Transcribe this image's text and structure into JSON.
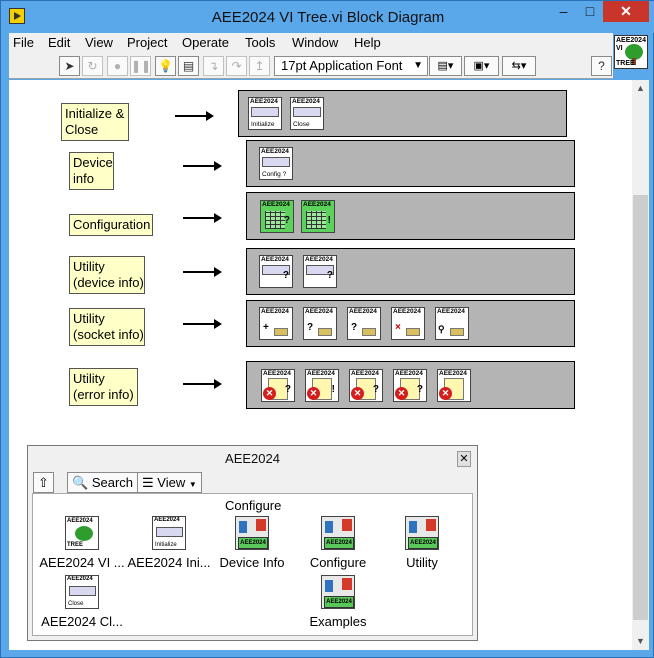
{
  "window": {
    "title": "AEE2024 VI Tree.vi Block Diagram",
    "min_label": "–",
    "max_label": "□",
    "close_label": "✕"
  },
  "menu": [
    "File",
    "Edit",
    "View",
    "Project",
    "Operate",
    "Tools",
    "Window",
    "Help"
  ],
  "toolbar": {
    "font": "17pt Application Font",
    "help_label": "?"
  },
  "vi_icon": {
    "top": "AEE2024",
    "mid": "VI",
    "bottom": "TREE"
  },
  "diagram": {
    "labels": [
      "Initialize &\nClose",
      "Device\ninfo",
      "Configuration",
      "Utility\n(device info)",
      "Utility\n(socket info)",
      "Utility\n(error info)"
    ],
    "header": "AEE2024",
    "captions": {
      "initialize": "Initialize",
      "close": "Close",
      "config": "Config ?"
    },
    "marks": {
      "query": "?",
      "bang": "!",
      "plus": "+",
      "cross": "×",
      "err": "✕"
    }
  },
  "palette": {
    "title": "AEE2024",
    "close": "✕",
    "up_label": "⇧",
    "search_label": "Search",
    "view_label": "View",
    "group_label": "Configure",
    "items": [
      {
        "label": "AEE2024 VI ...",
        "icon": "vi-tree-icon"
      },
      {
        "label": "AEE2024 Ini...",
        "icon": "initialize-icon"
      },
      {
        "label": "Device Info",
        "icon": "folder-icon"
      },
      {
        "label": "Configure",
        "icon": "folder-icon"
      },
      {
        "label": "Utility",
        "icon": "folder-icon"
      },
      {
        "label": "AEE2024 Cl...",
        "icon": "close-icon"
      },
      {
        "label": "Examples",
        "icon": "folder-icon"
      }
    ]
  },
  "colors": {
    "titlebar": "#5aa7ea",
    "group_bg": "#b4b4b4",
    "label_bg": "#ffffc8",
    "green_icon": "#5cd15c",
    "error_red": "#d41e1e"
  }
}
